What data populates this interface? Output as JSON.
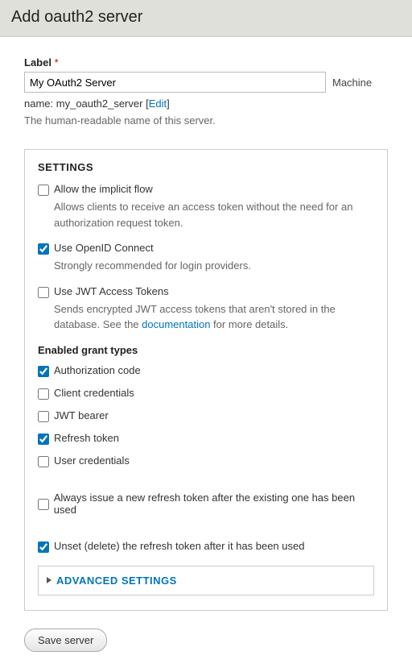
{
  "page": {
    "title": "Add oauth2 server"
  },
  "label": {
    "text": "Label",
    "required": "*",
    "value": "My OAuth2 Server",
    "machine_word": "Machine",
    "name_prefix": "name:",
    "machine_name": "my_oauth2_server",
    "edit": "Edit",
    "help": "The human-readable name of this server."
  },
  "settings": {
    "heading": "SETTINGS",
    "implicit": {
      "label": "Allow the implicit flow",
      "desc": "Allows clients to receive an access token without the need for an authorization request token."
    },
    "openid": {
      "label": "Use OpenID Connect",
      "desc": "Strongly recommended for login providers."
    },
    "jwt": {
      "label": "Use JWT Access Tokens",
      "desc_prefix": "Sends encrypted JWT access tokens that aren't stored in the database. See the ",
      "doc_link": "documentation",
      "desc_suffix": " for more details."
    }
  },
  "grants": {
    "heading": "Enabled grant types",
    "auth_code": "Authorization code",
    "client_creds": "Client credentials",
    "jwt_bearer": "JWT bearer",
    "refresh": "Refresh token",
    "user_creds": "User credentials"
  },
  "refresh_options": {
    "always_new": "Always issue a new refresh token after the existing one has been used",
    "unset": "Unset (delete) the refresh token after it has been used"
  },
  "advanced": {
    "heading": "ADVANCED SETTINGS"
  },
  "buttons": {
    "save": "Save server"
  }
}
